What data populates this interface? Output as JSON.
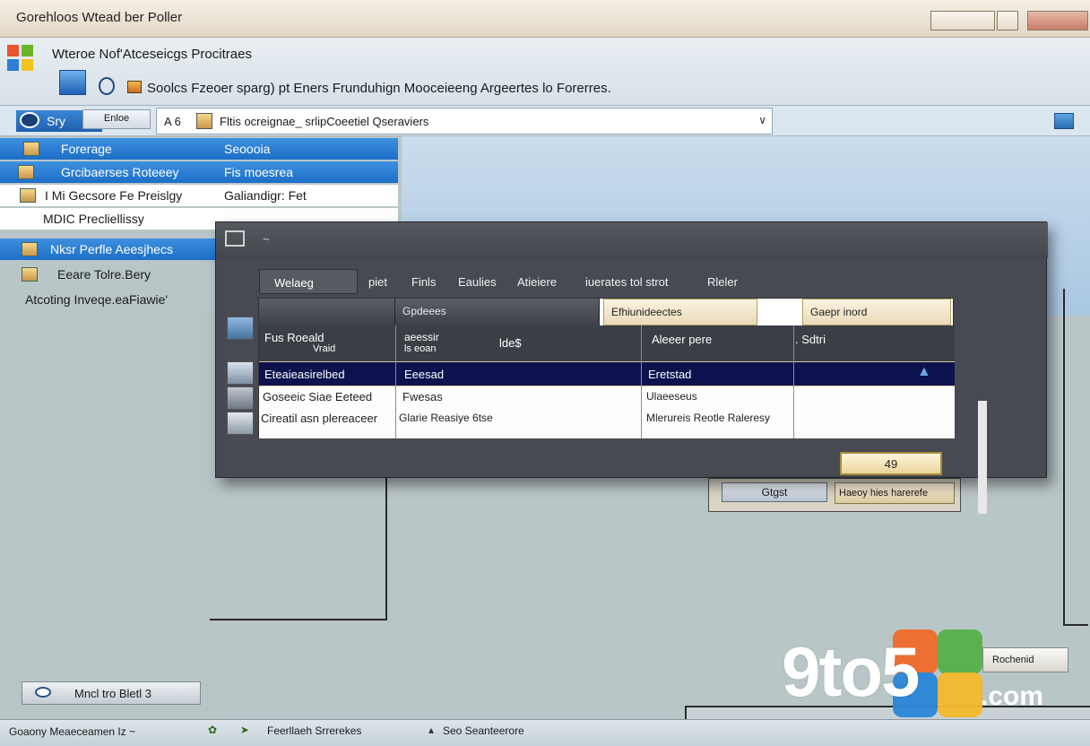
{
  "window": {
    "title": "Gorehloos Wtead ber Poller"
  },
  "header": {
    "app_name": "Wteroe Nof'Atceseicgs Procitraes",
    "subline": "Soolcs Fzeoer sparg) pt Eners Frunduhign  Mooceieeng Argeertes lo Forerres."
  },
  "address": {
    "nav_label": "Sry",
    "nav_button": "Enloe",
    "crumb": "A 6",
    "path": "Fltis ocreignae_  srlipCoeetiel Qseraviers"
  },
  "nav": {
    "items": [
      {
        "label": "Forerage",
        "value": "Seoooia"
      },
      {
        "label": "Grcibaerses Roteeey",
        "value": "Fis moesrea"
      },
      {
        "label": "I Mi Gecsore Fe Preislgy",
        "value": "Galiandigr: Fet"
      },
      {
        "label": "MDIC Precliellissy",
        "value": ""
      },
      {
        "label": "Nksr Perfle Aeesjhecs",
        "value": ""
      },
      {
        "label": "Eeare Tolre.Bery",
        "value": ""
      },
      {
        "label": "Atcoting Inveqe.eaFiawie'",
        "value": ""
      }
    ]
  },
  "dialog": {
    "caption": "~",
    "menu": [
      "Welaeg",
      "piet",
      "Finls",
      "Eaulies",
      "Atieiere",
      "iuerates tol strot",
      "Rleler"
    ],
    "columns": [
      "",
      "Gpdeees",
      "Efhiunideectes",
      "Gaepr inord"
    ],
    "rows": [
      {
        "c1": "Fus  Roeald",
        "c1b": "Vraid",
        "c2": "aeessir",
        "c2b": "ls eoan",
        "c3": "lde$",
        "c4": "Aleeer pere",
        "c5": ". Sdtri"
      },
      {
        "c1": "Eteaieasirelbed",
        "c2": "Eeesad",
        "c3": "",
        "c4": "Eretstad",
        "c5": ""
      },
      {
        "c1": "Goseeic Siae Eeteed",
        "c2": "Fwesas",
        "c3": "",
        "c4": "Ulaeeseus",
        "c5": ""
      },
      {
        "c1": "Cireatil asn plereaceer",
        "c2": "Glarie Reasiye 6tse",
        "c3": "",
        "c4": "Mlerureis Reotle Raleresy",
        "c5": ""
      }
    ],
    "ok_button": "49"
  },
  "subpanel": {
    "button1": "Gtgst",
    "button2": "Haeoy hies harerefe"
  },
  "bottom": {
    "left_button": "Mncl tro Bletl 3",
    "right_button": "Rochenid"
  },
  "statusbar": {
    "left": "Goaony Meaeceamen Iz ~",
    "middle": "Feerllaeh  Srrerekes",
    "right": "Seo  Seanteerore"
  },
  "watermark": {
    "text": "9to5",
    "suffix": ".com"
  },
  "colors": {
    "accent": "#1d6fc7",
    "dialog_bg": "#474a52",
    "selection_row": "#0d124f"
  }
}
